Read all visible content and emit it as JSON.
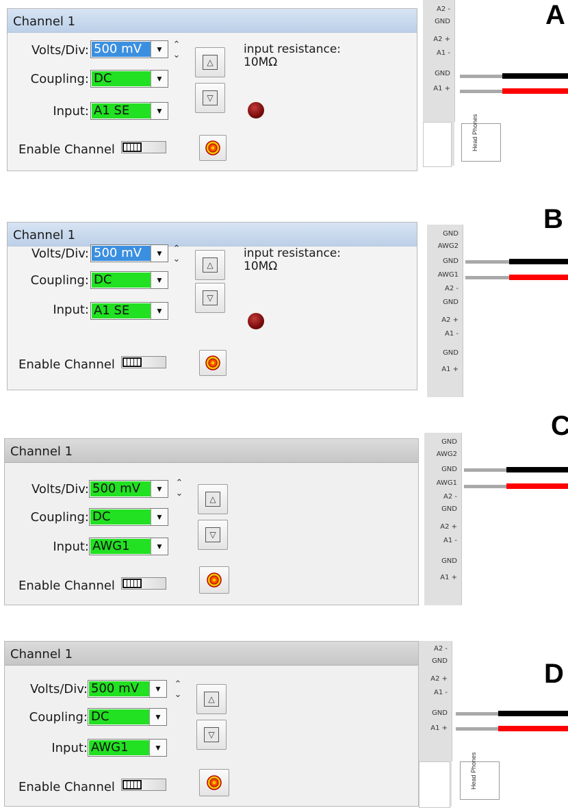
{
  "panels": [
    {
      "letter": "A",
      "title": "Channel 1",
      "volts_label": "Volts/Div:",
      "volts_value": "500 mV",
      "coupling_label": "Coupling:",
      "coupling_value": "DC",
      "input_label": "Input:",
      "input_value": "A1 SE",
      "enable_label": "Enable Channel",
      "resistance_line1": "input resistance:",
      "resistance_line2": "10MΩ",
      "pins": [
        "A2 -",
        "GND",
        "A2 +",
        "A1 -",
        "GND",
        "A1 +"
      ],
      "headphones": "Head Phones"
    },
    {
      "letter": "B",
      "title": "Channel 1",
      "volts_label": "Volts/Div:",
      "volts_value": "500 mV",
      "coupling_label": "Coupling:",
      "coupling_value": "DC",
      "input_label": "Input:",
      "input_value": "A1 SE",
      "enable_label": "Enable Channel",
      "resistance_line1": "input resistance:",
      "resistance_line2": "10MΩ",
      "pins": [
        "GND",
        "AWG2",
        "GND",
        "AWG1",
        "A2 -",
        "GND",
        "A2 +",
        "A1 -",
        "GND",
        "A1 +"
      ]
    },
    {
      "letter": "C",
      "title": "Channel 1",
      "volts_label": "Volts/Div:",
      "volts_value": "500 mV",
      "coupling_label": "Coupling:",
      "coupling_value": "DC",
      "input_label": "Input:",
      "input_value": "AWG1",
      "enable_label": "Enable Channel",
      "pins": [
        "GND",
        "AWG2",
        "GND",
        "AWG1",
        "A2 -",
        "GND",
        "A2 +",
        "A1 -",
        "GND",
        "A1 +"
      ]
    },
    {
      "letter": "D",
      "title": "Channel 1",
      "volts_label": "Volts/Div:",
      "volts_value": "500 mV",
      "coupling_label": "Coupling:",
      "coupling_value": "DC",
      "input_label": "Input:",
      "input_value": "AWG1",
      "enable_label": "Enable Channel",
      "pins": [
        "A2 -",
        "GND",
        "A2 +",
        "A1 -",
        "GND",
        "A1 +"
      ],
      "headphones": "Head Phones"
    }
  ],
  "icons": {
    "dropdown": "chevron-down-icon",
    "spinner": "up-down-spinner-icon",
    "scale_up": "triangle-up-icon",
    "scale_down": "triangle-down-icon",
    "record": "record-target-icon",
    "led": "status-led-icon"
  },
  "colors": {
    "combo_green": "#22e022",
    "selected_blue": "#3b8fe0",
    "wire_black": "#000000",
    "wire_red": "#ff0000",
    "wire_gray": "#a9a9a9",
    "led_red": "#7a0c0c"
  }
}
